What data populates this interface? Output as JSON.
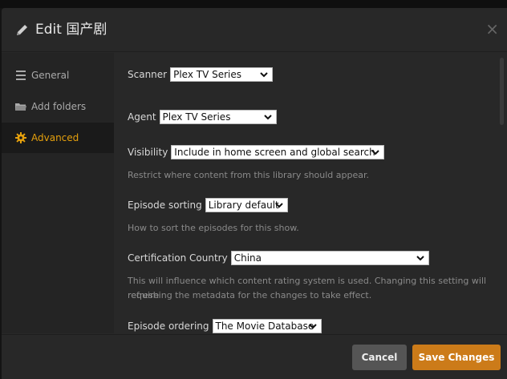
{
  "header": {
    "title": "Edit 国产剧",
    "close": "×"
  },
  "sidebar": {
    "items": [
      {
        "label": "General",
        "icon": "list-icon"
      },
      {
        "label": "Add folders",
        "icon": "folder-icon"
      },
      {
        "label": "Advanced",
        "icon": "gear-icon",
        "active": true
      }
    ]
  },
  "form": {
    "scanner": {
      "label": "Scanner",
      "value": "Plex TV Series"
    },
    "agent": {
      "label": "Agent",
      "value": "Plex TV Series"
    },
    "visibility": {
      "label": "Visibility",
      "value": "Include in home screen and global search",
      "help": "Restrict where content from this library should appear."
    },
    "episode_sorting": {
      "label": "Episode sorting",
      "value": "Library default",
      "help": "How to sort the episodes for this show."
    },
    "certification_country": {
      "label": "Certification Country",
      "value": "China",
      "help_line1": "This will influence which content rating system is used. Changing this setting will require",
      "help_line2": "refreshing the metadata for the changes to take effect."
    },
    "episode_ordering": {
      "label": "Episode ordering",
      "value": "The Movie Database"
    }
  },
  "footer": {
    "cancel_label": "Cancel",
    "save_label": "Save Changes"
  },
  "colors": {
    "accent": "#e5a00d",
    "save_button": "#cc7b19",
    "cancel_button": "#555555"
  }
}
